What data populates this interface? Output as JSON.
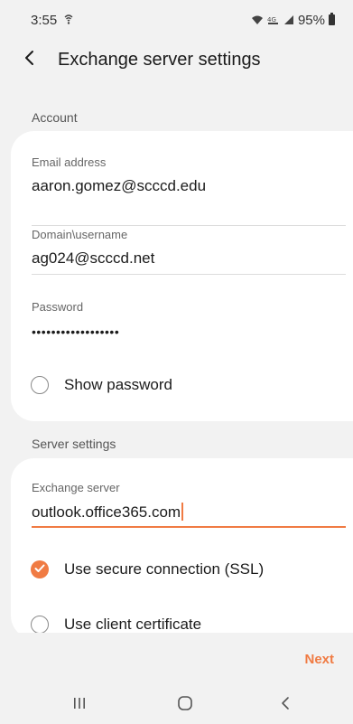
{
  "status_bar": {
    "time": "3:55",
    "battery": "95%"
  },
  "header": {
    "title": "Exchange server settings"
  },
  "account": {
    "section_title": "Account",
    "email_label": "Email address",
    "email_value": "aaron.gomez@scccd.edu",
    "domain_label": "Domain\\username",
    "domain_value": "ag024@scccd.net",
    "password_label": "Password",
    "password_value": "••••••••••••••••••",
    "show_password_label": "Show password",
    "show_password_checked": false
  },
  "server": {
    "section_title": "Server settings",
    "exchange_label": "Exchange server",
    "exchange_value": "outlook.office365.com",
    "ssl_label": "Use secure connection (SSL)",
    "ssl_checked": true,
    "client_cert_label": "Use client certificate",
    "client_cert_checked": false
  },
  "footer": {
    "next_label": "Next"
  },
  "colors": {
    "accent": "#f07b43",
    "background": "#f2f2f2",
    "card": "#ffffff"
  }
}
